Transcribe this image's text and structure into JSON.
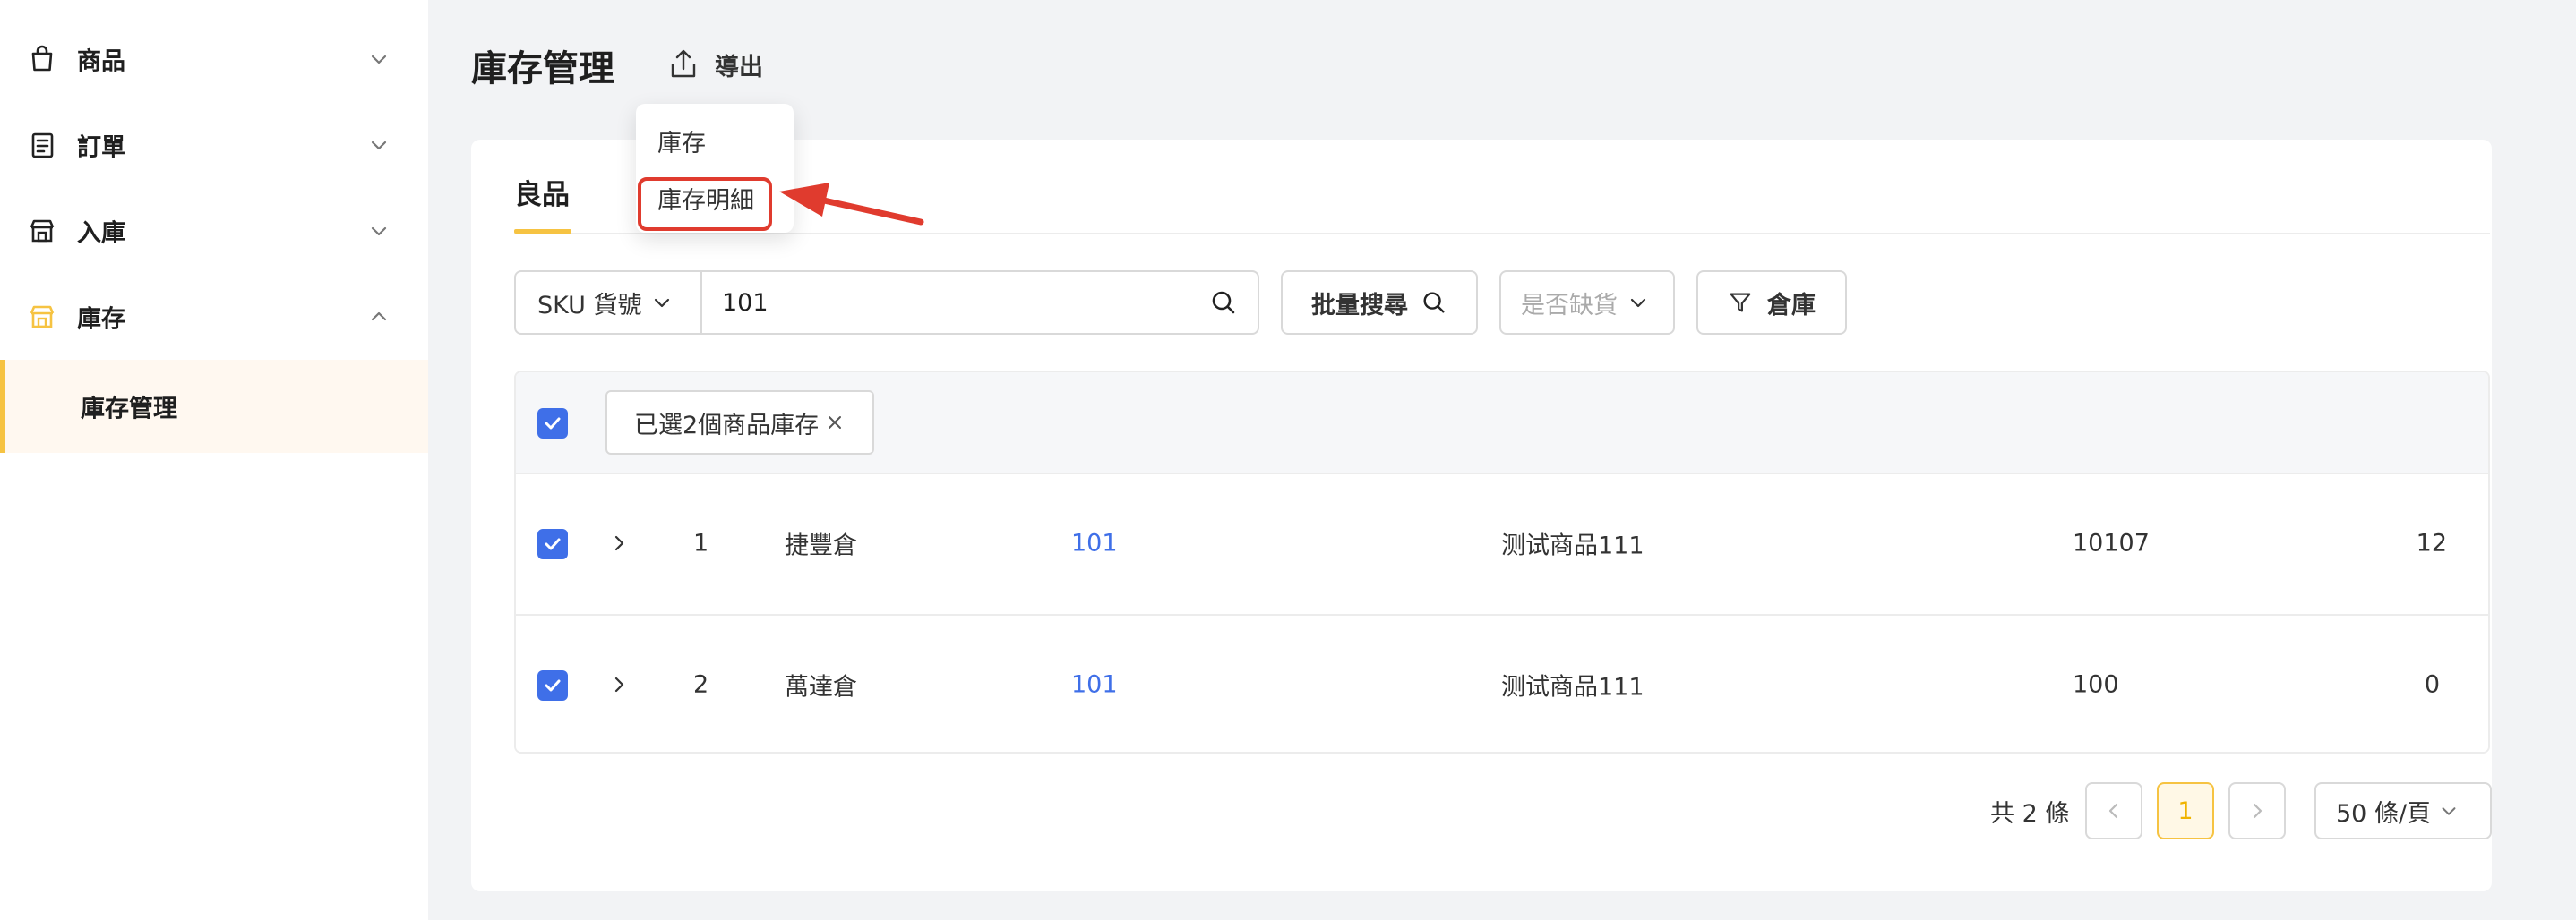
{
  "sidebar": {
    "items": [
      {
        "label": "商品",
        "icon": "shopping-bag-icon",
        "expanded": false
      },
      {
        "label": "訂單",
        "icon": "order-list-icon",
        "expanded": false
      },
      {
        "label": "入庫",
        "icon": "inbound-store-icon",
        "expanded": false
      },
      {
        "label": "庫存",
        "icon": "warehouse-icon",
        "expanded": true
      }
    ],
    "sub_items": [
      {
        "label": "庫存管理",
        "active": true
      }
    ],
    "accent_color": "#f6c342"
  },
  "header": {
    "title": "庫存管理",
    "export_label": "導出",
    "export_icon": "upload-icon"
  },
  "export_menu": {
    "items": [
      "庫存",
      "庫存明細"
    ],
    "highlighted_index": 1
  },
  "tabs": {
    "active": "良品"
  },
  "filters": {
    "field_select": "SKU 貨號",
    "search_value": "101",
    "batch_search_label": "批量搜尋",
    "stock_select_placeholder": "是否缺貨",
    "warehouse_label": "倉庫"
  },
  "table": {
    "selection_tag": "已選2個商品庫存",
    "rows": [
      {
        "index": "1",
        "warehouse": "捷豐倉",
        "sku": "101",
        "name": "测试商品111",
        "barcode": "10107",
        "qty": "12",
        "checked": true
      },
      {
        "index": "2",
        "warehouse": "萬達倉",
        "sku": "101",
        "name": "测试商品111",
        "barcode": "100",
        "qty": "0",
        "checked": true
      }
    ]
  },
  "pagination": {
    "total_text": "共 2 條",
    "current_page": "1",
    "page_size": "50 條/頁"
  },
  "colors": {
    "primary_blue": "#3f6fe8",
    "highlight_red": "#e03b2e"
  }
}
